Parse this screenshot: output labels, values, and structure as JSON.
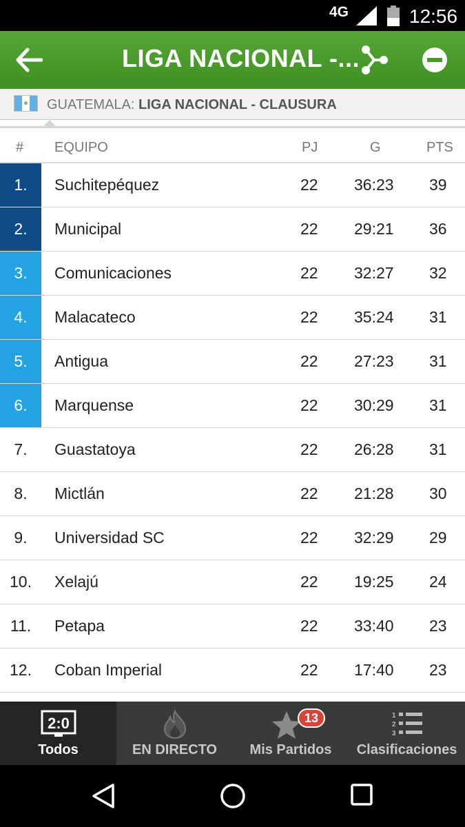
{
  "status_bar": {
    "network": "4G",
    "time": "12:56"
  },
  "app_bar": {
    "title": "LIGA NACIONAL -..."
  },
  "breadcrumb": {
    "country": "GUATEMALA:",
    "league": "LIGA NACIONAL - CLAUSURA"
  },
  "table": {
    "headers": {
      "rank": "#",
      "team": "EQUIPO",
      "played": "PJ",
      "goals": "G",
      "points": "PTS"
    },
    "rows": [
      {
        "rank": "1.",
        "team": "Suchitepéquez",
        "played": "22",
        "goals": "36:23",
        "points": "39",
        "zone": "dark"
      },
      {
        "rank": "2.",
        "team": "Municipal",
        "played": "22",
        "goals": "29:21",
        "points": "36",
        "zone": "dark"
      },
      {
        "rank": "3.",
        "team": "Comunicaciones",
        "played": "22",
        "goals": "32:27",
        "points": "32",
        "zone": "light"
      },
      {
        "rank": "4.",
        "team": "Malacateco",
        "played": "22",
        "goals": "35:24",
        "points": "31",
        "zone": "light"
      },
      {
        "rank": "5.",
        "team": "Antigua",
        "played": "22",
        "goals": "27:23",
        "points": "31",
        "zone": "light"
      },
      {
        "rank": "6.",
        "team": "Marquense",
        "played": "22",
        "goals": "30:29",
        "points": "31",
        "zone": "light"
      },
      {
        "rank": "7.",
        "team": "Guastatoya",
        "played": "22",
        "goals": "26:28",
        "points": "31",
        "zone": ""
      },
      {
        "rank": "8.",
        "team": "Mictlán",
        "played": "22",
        "goals": "21:28",
        "points": "30",
        "zone": ""
      },
      {
        "rank": "9.",
        "team": "Universidad SC",
        "played": "22",
        "goals": "32:29",
        "points": "29",
        "zone": ""
      },
      {
        "rank": "10.",
        "team": "Xelajú",
        "played": "22",
        "goals": "19:25",
        "points": "24",
        "zone": ""
      },
      {
        "rank": "11.",
        "team": "Petapa",
        "played": "22",
        "goals": "33:40",
        "points": "23",
        "zone": ""
      },
      {
        "rank": "12.",
        "team": "Coban Imperial",
        "played": "22",
        "goals": "17:40",
        "points": "23",
        "zone": ""
      }
    ]
  },
  "tabs": [
    {
      "label": "Todos",
      "icon": "scoreboard-icon",
      "icon_text": "2:0",
      "active": true
    },
    {
      "label": "EN DIRECTO",
      "icon": "flame-icon",
      "active": false
    },
    {
      "label": "Mis Partidos",
      "icon": "star-icon",
      "active": false,
      "badge": "13"
    },
    {
      "label": "Clasificaciones",
      "icon": "ranked-list-icon",
      "active": false
    }
  ],
  "colors": {
    "app_bar": "#4a9a2b",
    "zone_dark": "#0d4a86",
    "zone_light": "#23a3e3",
    "badge": "#d9433a"
  }
}
